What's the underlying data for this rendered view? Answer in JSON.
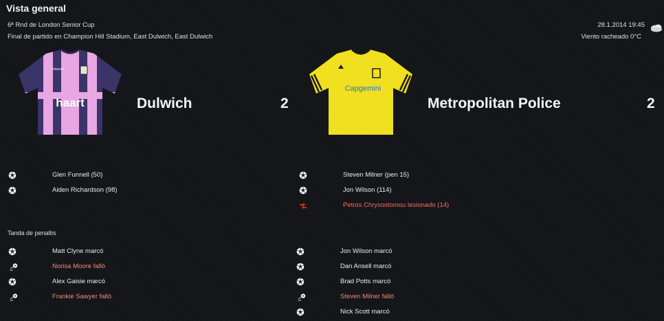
{
  "header": {
    "title": "Vista general",
    "competition": "6ª Rnd de London Senior Cup",
    "datetime": "28.1.2014 19:45",
    "venue_line": "Final de partido en Champion Hill Stadium, East Dulwich, East Dulwich",
    "weather": "Viento racheado 0°C",
    "weather_icon": "cloud-icon"
  },
  "home": {
    "name": "Dulwich",
    "score": "2",
    "kit_colors": {
      "base": "#3a3468",
      "stripes": "#e8a6e2",
      "sponsor": "haart"
    },
    "goals": [
      {
        "icon": "ball-icon",
        "text": "Glen Funnell (50)"
      },
      {
        "icon": "ball-icon",
        "text": "Aiden Richardson (98)"
      }
    ]
  },
  "away": {
    "name": "Metropolitan Police",
    "score": "2",
    "kit_colors": {
      "base": "#f0e020",
      "trim": "#1a1a1a",
      "sponsor": "Capgemini"
    },
    "goals": [
      {
        "icon": "ball-icon",
        "text": "Steven Milner (pen 15)"
      },
      {
        "icon": "ball-icon",
        "text": "Jon Wilson (114)"
      },
      {
        "icon": "injury-sub-icon",
        "text": "Petros Chrysostomou lesionado (14)",
        "status": "injury"
      }
    ]
  },
  "shootout": {
    "label": "Tanda de penaltis",
    "home": [
      {
        "icon": "ball-icon",
        "text": "Matt Clyne marcó",
        "result": "scored"
      },
      {
        "icon": "missed-penalty-icon",
        "text": "Norisa Moore falló",
        "result": "missed"
      },
      {
        "icon": "ball-icon",
        "text": "Alex Gaisie marcó",
        "result": "scored"
      },
      {
        "icon": "missed-penalty-icon",
        "text": "Frankie Sawyer falló",
        "result": "missed"
      }
    ],
    "away": [
      {
        "icon": "ball-icon",
        "text": "Jon Wilson marcó",
        "result": "scored"
      },
      {
        "icon": "ball-icon",
        "text": "Dan Ansell marcó",
        "result": "scored"
      },
      {
        "icon": "ball-icon",
        "text": "Brad Potts marcó",
        "result": "scored"
      },
      {
        "icon": "missed-penalty-icon",
        "text": "Steven Milner falló",
        "result": "missed"
      },
      {
        "icon": "ball-icon",
        "text": "Nick Scott marcó",
        "result": "scored"
      }
    ]
  }
}
